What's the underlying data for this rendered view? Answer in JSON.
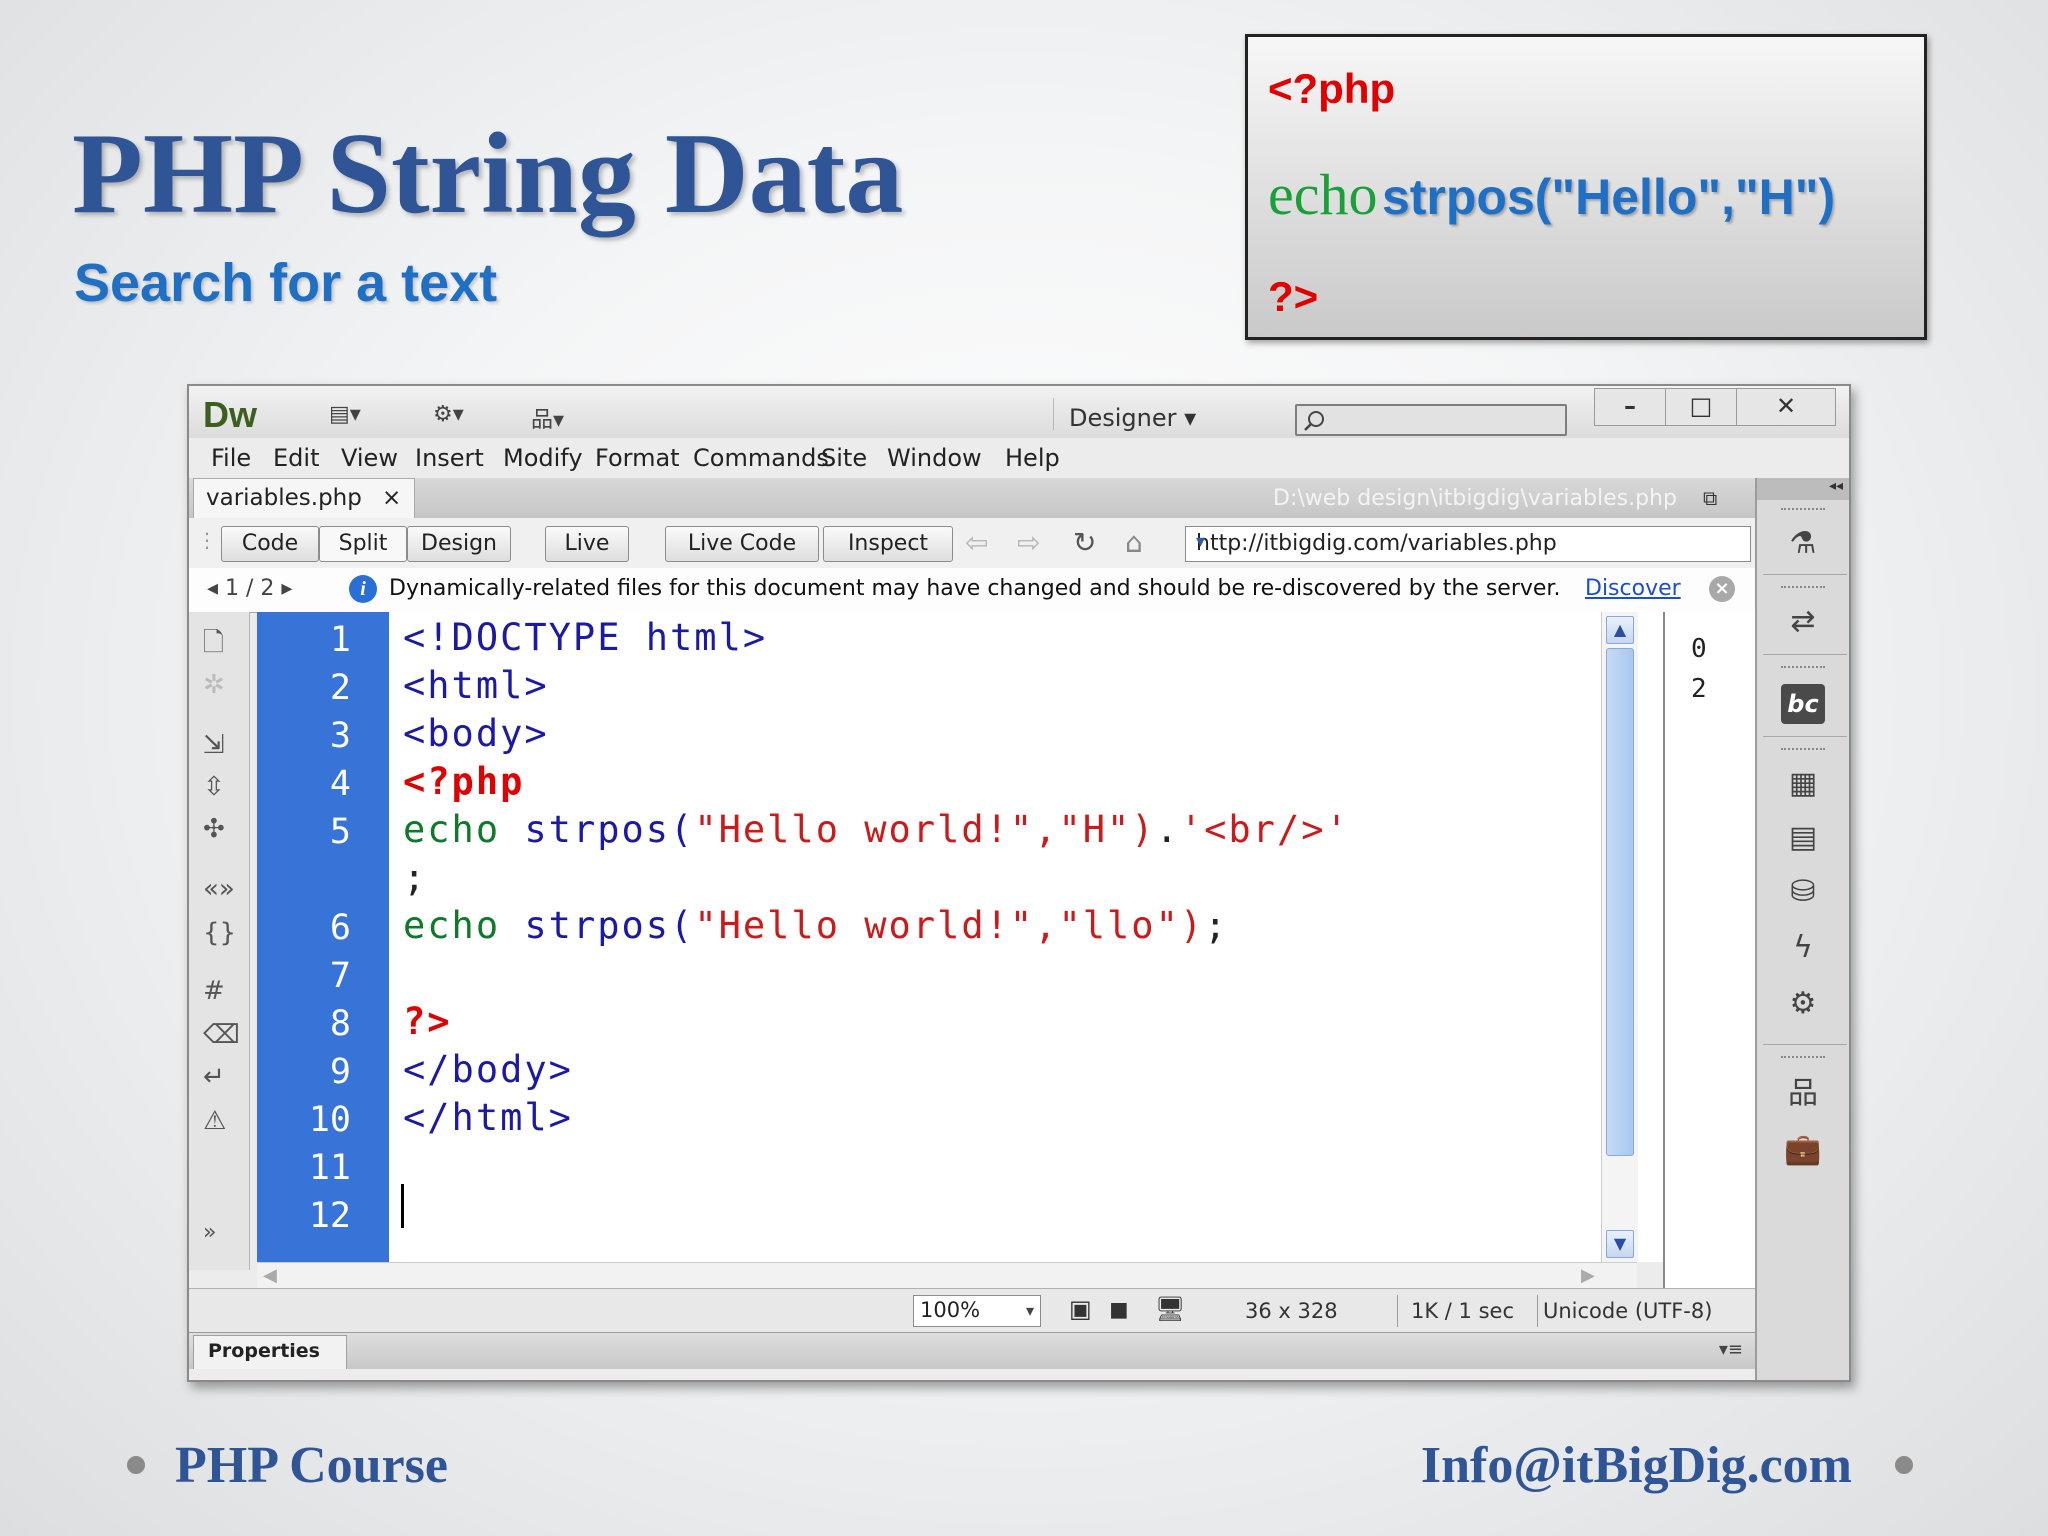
{
  "slide": {
    "title": "PHP String Data",
    "subtitle": "Search for a text",
    "codebox": {
      "open_tag": "<?php",
      "echo_kw": "echo",
      "call": "strpos(\"Hello\",\"H\")",
      "close_tag": "?>"
    },
    "footer_left": "PHP Course",
    "footer_right": "Info@itBigDig.com"
  },
  "dw": {
    "logo": "Dw",
    "workspace": "Designer",
    "window_buttons": [
      "–",
      "□",
      "✕"
    ],
    "menu": [
      "File",
      "Edit",
      "View",
      "Insert",
      "Modify",
      "Format",
      "Commands",
      "Site",
      "Window",
      "Help"
    ],
    "tab": {
      "filename": "variables.php",
      "close": "×"
    },
    "filepath": "D:\\web design\\itbigdig\\variables.php",
    "view_buttons": [
      "Code",
      "Split",
      "Design",
      "Live"
    ],
    "live_code": "Live Code",
    "inspect": "Inspect",
    "url": "http://itbigdig.com/variables.php",
    "infobar": {
      "pager": "◂  1 / 2  ▸",
      "message": "Dynamically-related files for this document may have changed and should be re-discovered by the server.",
      "link": "Discover"
    },
    "line_numbers": [
      "1",
      "2",
      "3",
      "4",
      "5",
      "6",
      "7",
      "8",
      "9",
      "10",
      "11",
      "12"
    ],
    "code": {
      "l1": "<!DOCTYPE html>",
      "l2": "<html>",
      "l3": "<body>",
      "l4": "<?php",
      "l5_echo": "echo",
      "l5_fn": "strpos(",
      "l5_args": "\"Hello world!\",\"H\")",
      "l5_dot": ".",
      "l5_br": "'<br/>'",
      "l5_semi": ";",
      "l6_echo": "echo",
      "l6_fn": "strpos(",
      "l6_args": "\"Hello world!\",\"llo\")",
      "l6_semi": ";",
      "l8": "?>",
      "l9": "</body>",
      "l10": "</html>"
    },
    "live_output": [
      "0",
      "2"
    ],
    "status": {
      "zoom": "100%",
      "dimensions": "36 x 328",
      "download": "1K / 1 sec",
      "encoding": "Unicode (UTF-8)"
    },
    "properties": "Properties"
  },
  "colors": {
    "title_blue": "#2f5597",
    "subtitle_blue": "#1f6fc4",
    "php_red": "#e00000",
    "echo_green": "#1aa038",
    "gutter_blue": "#3874d8"
  }
}
